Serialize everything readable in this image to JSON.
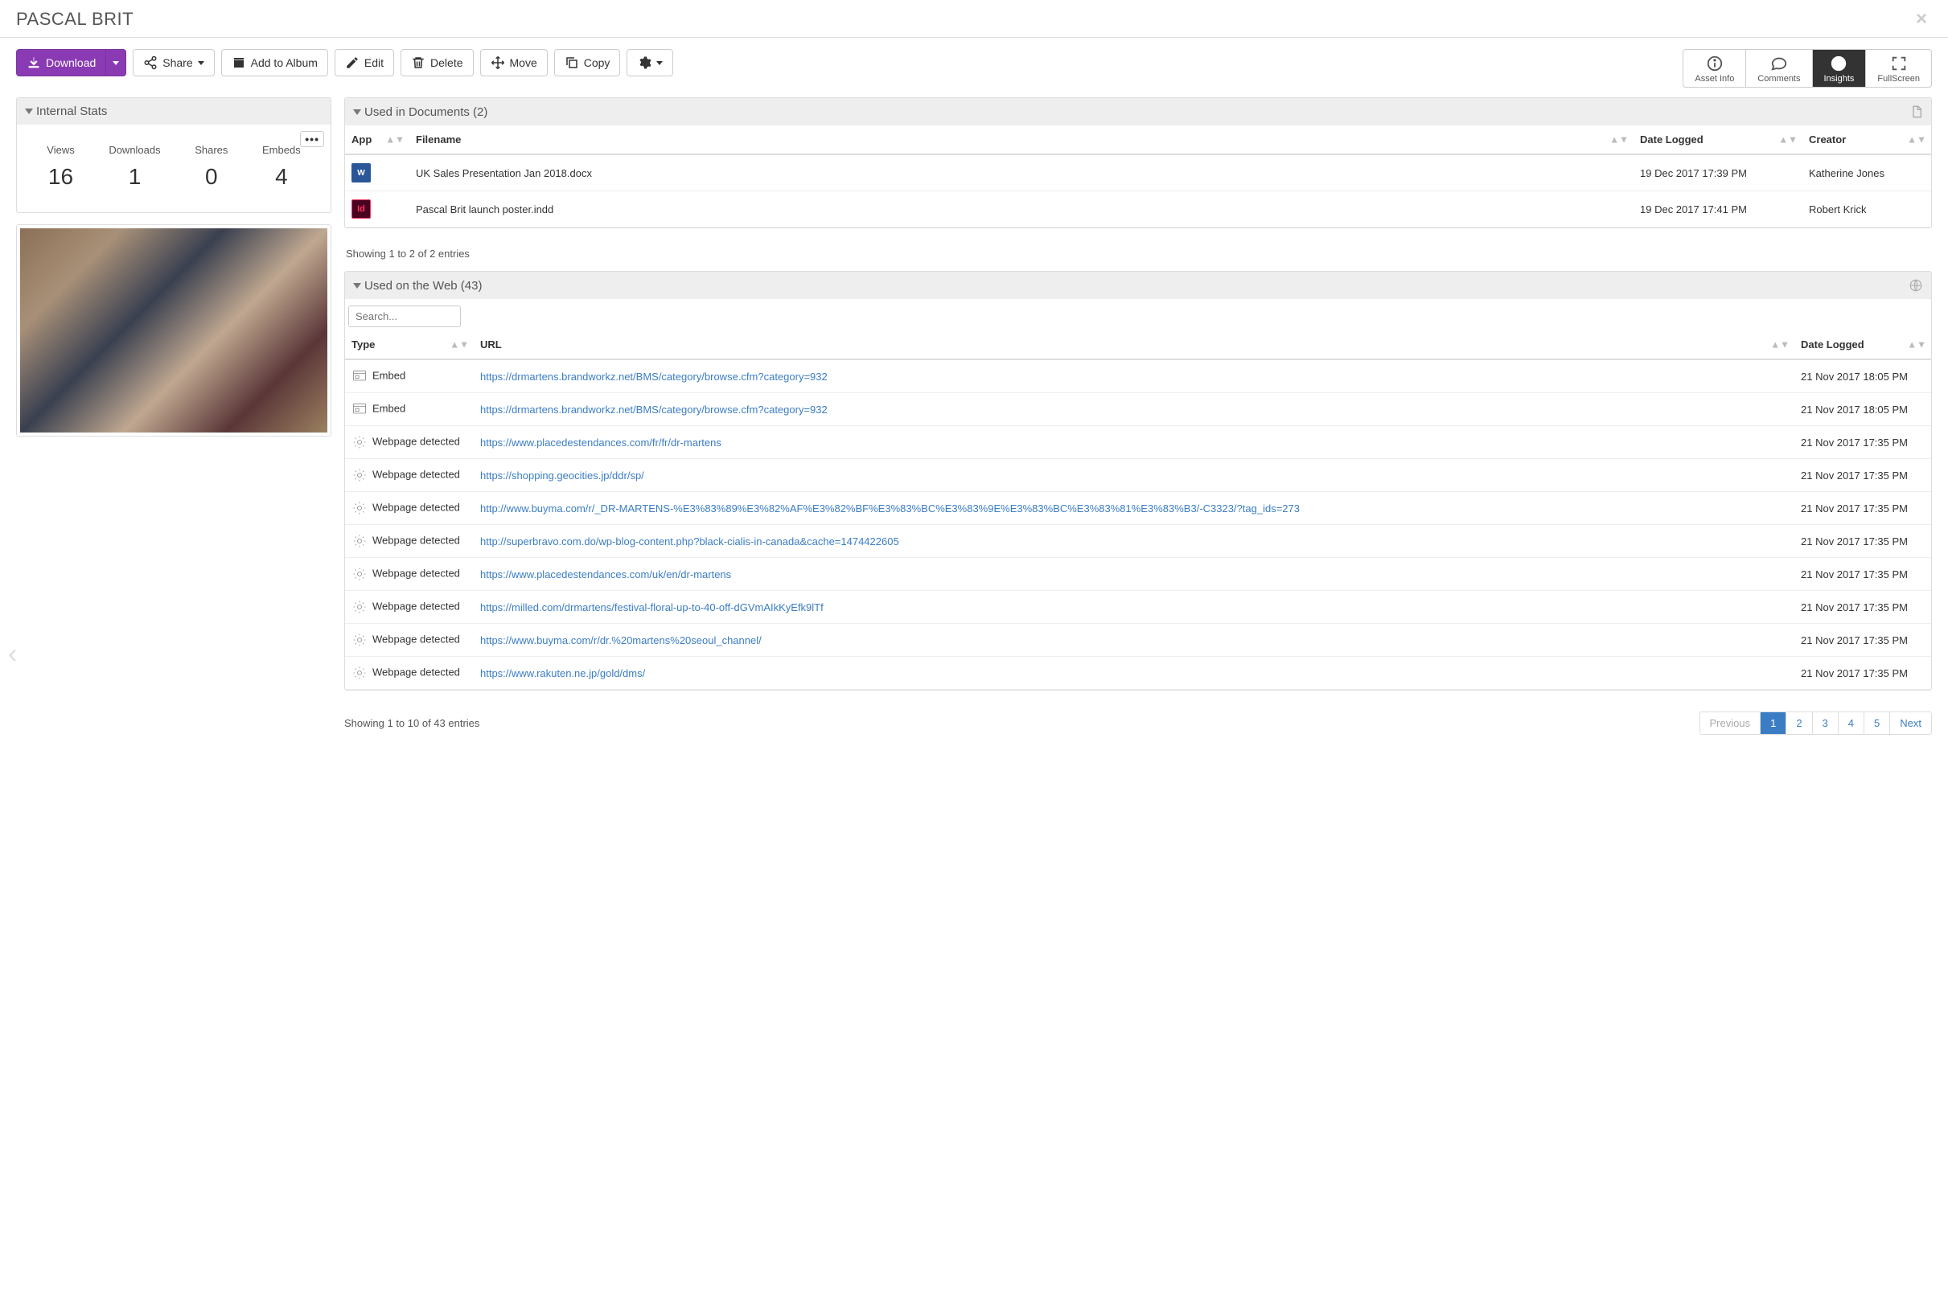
{
  "title": "PASCAL BRIT",
  "toolbar": {
    "download": "Download",
    "share": "Share",
    "add_album": "Add to Album",
    "edit": "Edit",
    "delete": "Delete",
    "move": "Move",
    "copy": "Copy"
  },
  "tabs": {
    "asset_info": "Asset Info",
    "comments": "Comments",
    "insights": "Insights",
    "fullscreen": "FullScreen"
  },
  "stats": {
    "header": "Internal Stats",
    "views_label": "Views",
    "views": "16",
    "downloads_label": "Downloads",
    "downloads": "1",
    "shares_label": "Shares",
    "shares": "0",
    "embeds_label": "Embeds",
    "embeds": "4"
  },
  "docs": {
    "header": "Used in Documents (2)",
    "col_app": "App",
    "col_filename": "Filename",
    "col_date": "Date Logged",
    "col_creator": "Creator",
    "rows": [
      {
        "app": "W",
        "filename": "UK Sales Presentation Jan 2018.docx",
        "date": "19 Dec 2017 17:39 PM",
        "creator": "Katherine Jones"
      },
      {
        "app": "Id",
        "filename": "Pascal Brit launch poster.indd",
        "date": "19 Dec 2017 17:41 PM",
        "creator": "Robert Krick"
      }
    ],
    "showing": "Showing 1 to 2 of 2 entries"
  },
  "web": {
    "header": "Used on the Web (43)",
    "search_placeholder": "Search...",
    "col_type": "Type",
    "col_url": "URL",
    "col_date": "Date Logged",
    "rows": [
      {
        "type": "Embed",
        "icon": "embed",
        "url": "https://drmartens.brandworkz.net/BMS/category/browse.cfm?category=932",
        "date": "21 Nov 2017 18:05 PM"
      },
      {
        "type": "Embed",
        "icon": "embed",
        "url": "https://drmartens.brandworkz.net/BMS/category/browse.cfm?category=932",
        "date": "21 Nov 2017 18:05 PM"
      },
      {
        "type": "Webpage detected",
        "icon": "web",
        "url": "https://www.placedestendances.com/fr/fr/dr-martens",
        "date": "21 Nov 2017 17:35 PM"
      },
      {
        "type": "Webpage detected",
        "icon": "web",
        "url": "https://shopping.geocities.jp/ddr/sp/",
        "date": "21 Nov 2017 17:35 PM"
      },
      {
        "type": "Webpage detected",
        "icon": "web",
        "url": "http://www.buyma.com/r/_DR-MARTENS-%E3%83%89%E3%82%AF%E3%82%BF%E3%83%BC%E3%83%9E%E3%83%BC%E3%83%81%E3%83%B3/-C3323/?tag_ids=273",
        "date": "21 Nov 2017 17:35 PM"
      },
      {
        "type": "Webpage detected",
        "icon": "web",
        "url": "http://superbravo.com.do/wp-blog-content.php?black-cialis-in-canada&cache=1474422605",
        "date": "21 Nov 2017 17:35 PM"
      },
      {
        "type": "Webpage detected",
        "icon": "web",
        "url": "https://www.placedestendances.com/uk/en/dr-martens",
        "date": "21 Nov 2017 17:35 PM"
      },
      {
        "type": "Webpage detected",
        "icon": "web",
        "url": "https://milled.com/drmartens/festival-floral-up-to-40-off-dGVmAIkKyEfk9lTf",
        "date": "21 Nov 2017 17:35 PM"
      },
      {
        "type": "Webpage detected",
        "icon": "web",
        "url": "https://www.buyma.com/r/dr.%20martens%20seoul_channel/",
        "date": "21 Nov 2017 17:35 PM"
      },
      {
        "type": "Webpage detected",
        "icon": "web",
        "url": "https://www.rakuten.ne.jp/gold/dms/",
        "date": "21 Nov 2017 17:35 PM"
      }
    ],
    "showing": "Showing 1 to 10 of 43 entries",
    "pagination": {
      "previous": "Previous",
      "pages": [
        "1",
        "2",
        "3",
        "4",
        "5"
      ],
      "next": "Next"
    }
  }
}
